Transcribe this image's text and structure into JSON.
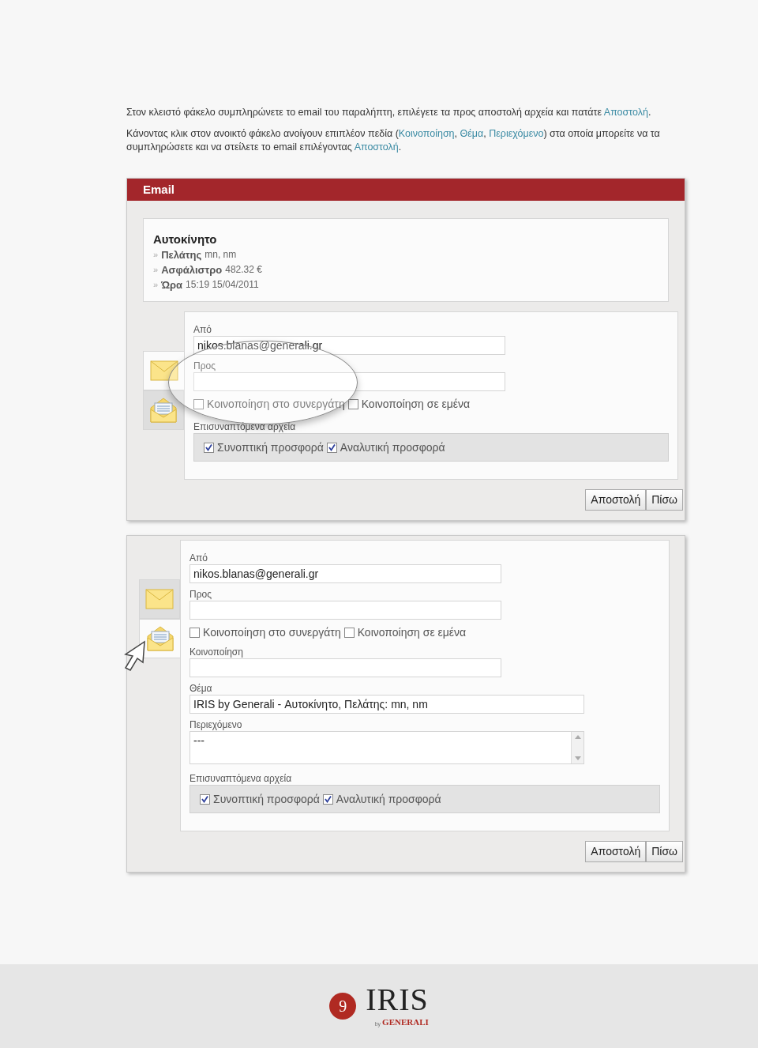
{
  "intro": [
    {
      "segments": [
        {
          "kind": "plain",
          "text": "Στον κλειστό φάκελο συμπληρώνετε το email του παραλήπτη, επιλέγετε τα προς αποστολή αρχεία και πατάτε "
        },
        {
          "kind": "link",
          "text": "Αποστολή"
        },
        {
          "kind": "plain",
          "text": "."
        }
      ]
    },
    {
      "segments": [
        {
          "kind": "plain",
          "text": "Κάνοντας κλικ στον ανοικτό φάκελο ανοίγουν επιπλέον πεδία ("
        },
        {
          "kind": "link",
          "text": "Κοινοποίηση"
        },
        {
          "kind": "plain",
          "text": ", "
        },
        {
          "kind": "link",
          "text": "Θέμα"
        },
        {
          "kind": "plain",
          "text": ", "
        },
        {
          "kind": "link",
          "text": "Περιεχόμενο"
        },
        {
          "kind": "plain",
          "text": ") στα οποία μπορείτε να τα συμπληρώσετε και να στείλετε το email επιλέγοντας "
        },
        {
          "kind": "link",
          "text": "Αποστολή"
        },
        {
          "kind": "plain",
          "text": "."
        }
      ]
    }
  ],
  "screens": [
    {
      "title": "Email",
      "summary": {
        "heading": "Αυτοκίνητο",
        "rows": [
          {
            "marker": "»",
            "label": "Πελάτης",
            "value": "mn, nm"
          },
          {
            "marker": "»",
            "label": "Ασφάλιστρο",
            "value": "482.32 €"
          },
          {
            "marker": "»",
            "label": "Ώρα",
            "value": "15:19 15/04/2011"
          }
        ]
      },
      "magnifier": true,
      "cursor": false,
      "tabs": [
        {
          "selected": true
        },
        {
          "selected": false
        }
      ],
      "fields": [
        {
          "kind": "text",
          "label": "Από",
          "value": "nikos.blanas@generali.gr"
        },
        {
          "kind": "text",
          "label": "Προς"
        },
        {
          "kind": "checks",
          "options": [
            {
              "label": "Κοινοποίηση στο συνεργάτη",
              "checked": false
            },
            {
              "label": "Κοινοποίηση σε εμένα",
              "checked": false
            }
          ]
        },
        {
          "kind": "attachments",
          "label": "Επισυναπτόμενα αρχεία",
          "options": [
            {
              "label": "Συνοπτική προσφορά",
              "checked": true
            },
            {
              "label": "Αναλυτική προσφορά",
              "checked": true
            }
          ]
        }
      ],
      "buttons": [
        "Αποστολή",
        "Πίσω"
      ]
    },
    {
      "magnifier": false,
      "cursor": true,
      "tabs": [
        {
          "selected": false
        },
        {
          "selected": true
        }
      ],
      "fields": [
        {
          "kind": "text",
          "label": "Από",
          "value": "nikos.blanas@generali.gr"
        },
        {
          "kind": "text",
          "label": "Προς"
        },
        {
          "kind": "checks",
          "options": [
            {
              "label": "Κοινοποίηση στο συνεργάτη",
              "checked": false
            },
            {
              "label": "Κοινοποίηση σε εμένα",
              "checked": false
            }
          ]
        },
        {
          "kind": "text",
          "label": "Κοινοποίηση"
        },
        {
          "kind": "wide",
          "label": "Θέμα",
          "value": "IRIS by Generali - Αυτοκίνητο, Πελάτης: mn, nm"
        },
        {
          "kind": "textarea",
          "label": "Περιεχόμενο",
          "value": "---"
        },
        {
          "kind": "attachments",
          "label": "Επισυναπτόμενα αρχεία",
          "options": [
            {
              "label": "Συνοπτική προσφορά",
              "checked": true
            },
            {
              "label": "Αναλυτική προσφορά",
              "checked": true
            }
          ]
        }
      ],
      "buttons": [
        "Αποστολή",
        "Πίσω"
      ]
    }
  ],
  "footer": {
    "page": "9",
    "logo": "IRIS",
    "by": "by",
    "brand": "GENERALI"
  }
}
